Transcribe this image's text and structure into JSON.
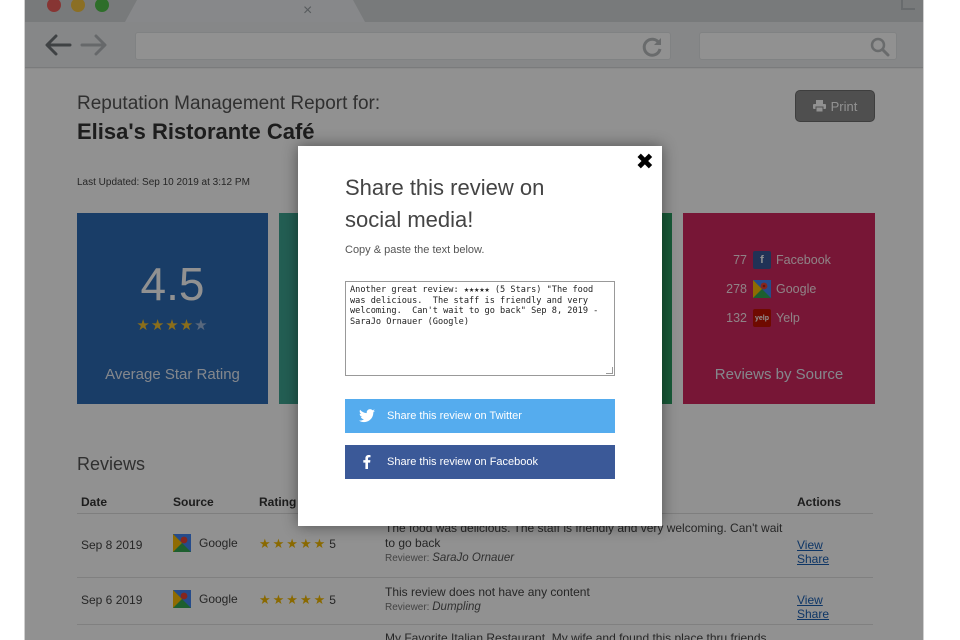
{
  "browser": {
    "tab_close": "×",
    "url": "",
    "search": ""
  },
  "report": {
    "heading": "Reputation Management Report for:",
    "business_name": "Elisa's Ristorante Café",
    "last_updated": "Last Updated: Sep 10 2019 at 3:12 PM",
    "print_label": "Print"
  },
  "cards": {
    "rating": {
      "value": "4.5",
      "stars_filled": 4,
      "stars_half": 1,
      "label": "Average Star Rating"
    },
    "sources": {
      "label": "Reviews by Source",
      "items": [
        {
          "count": "77",
          "name": "Facebook"
        },
        {
          "count": "278",
          "name": "Google"
        },
        {
          "count": "132",
          "name": "Yelp"
        }
      ]
    }
  },
  "reviews": {
    "title": "Reviews",
    "columns": [
      "Date",
      "Source",
      "Rating",
      "Actions"
    ],
    "rows": [
      {
        "date": "Sep 8 2019",
        "source": "Google",
        "stars": "★★★★★",
        "rating": "5",
        "text": "The food was delicious. The staff is friendly and very welcoming. Can't wait to go back",
        "reviewer_label": "Reviewer:",
        "reviewer": "SaraJo Ornauer",
        "view": "View",
        "share": "Share"
      },
      {
        "date": "Sep 6 2019",
        "source": "Google",
        "stars": "★★★★★",
        "rating": "5",
        "text": "This review does not have any content",
        "reviewer_label": "Reviewer:",
        "reviewer": "Dumpling",
        "view": "View",
        "share": "Share"
      },
      {
        "date": "",
        "source": "",
        "stars": "",
        "rating": "",
        "text": "My Favorite Italian Restaurant. My wife and found this place thru friends",
        "reviewer_label": "",
        "reviewer": "",
        "view": "",
        "share": ""
      }
    ]
  },
  "modal": {
    "close": "✖",
    "title": "Share this review on social media!",
    "subtitle": "Copy & paste the text below.",
    "text": "Another great review: ★★★★★ (5 Stars) \"The food was delicious.  The staff is friendly and very welcoming.  Can't wait to go back\" Sep 8, 2019 - SaraJo Ornauer (Google)",
    "twitter_label": "Share this review on Twitter",
    "facebook_label": "Share this review on Facebook"
  },
  "colors": {
    "rating_card": "#2c6bb5",
    "teal_card": "#3fa593",
    "green_card": "#2b9e63",
    "source_card": "#d2275f",
    "twitter": "#55acee",
    "facebook": "#3b5998"
  }
}
